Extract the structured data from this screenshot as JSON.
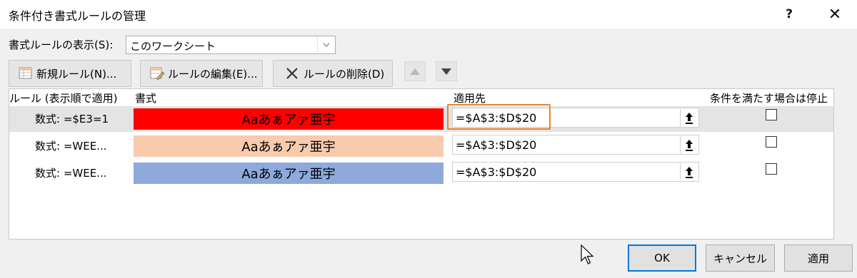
{
  "window": {
    "title": "条件付き書式ルールの管理",
    "help_label": "?",
    "close_label": "✕"
  },
  "show_rules": {
    "label": "書式ルールの表示(S):",
    "selected": "このワークシート"
  },
  "toolbar": {
    "new_rule": "新規ルール(N)...",
    "edit_rule": "ルールの編集(E)...",
    "delete_rule": "ルールの削除(D)"
  },
  "columns": {
    "rule": "ルール (表示順で適用)",
    "format": "書式",
    "applies_to": "適用先",
    "stop_if_true": "条件を満たす場合は停止"
  },
  "rules": [
    {
      "rule": "数式: =$E3=1",
      "preview": "Aaあぁアァ亜宇",
      "fill": "#ff0000",
      "text_color": "#000000",
      "applies_to": "=$A$3:$D$20",
      "stop": false,
      "selected": true
    },
    {
      "rule": "数式: =WEE...",
      "preview": "Aaあぁアァ亜宇",
      "fill": "#f8cbad",
      "text_color": "#000000",
      "applies_to": "=$A$3:$D$20",
      "stop": false,
      "selected": false
    },
    {
      "rule": "数式: =WEE...",
      "preview": "Aaあぁアァ亜宇",
      "fill": "#8ea9db",
      "text_color": "#000000",
      "applies_to": "=$A$3:$D$20",
      "stop": false,
      "selected": false
    }
  ],
  "buttons": {
    "ok": "OK",
    "cancel": "キャンセル",
    "apply": "適用"
  },
  "colors": {
    "focus": "#e4862a",
    "selected_row": "#e4e4e4",
    "default_button_border": "#0078d7"
  }
}
